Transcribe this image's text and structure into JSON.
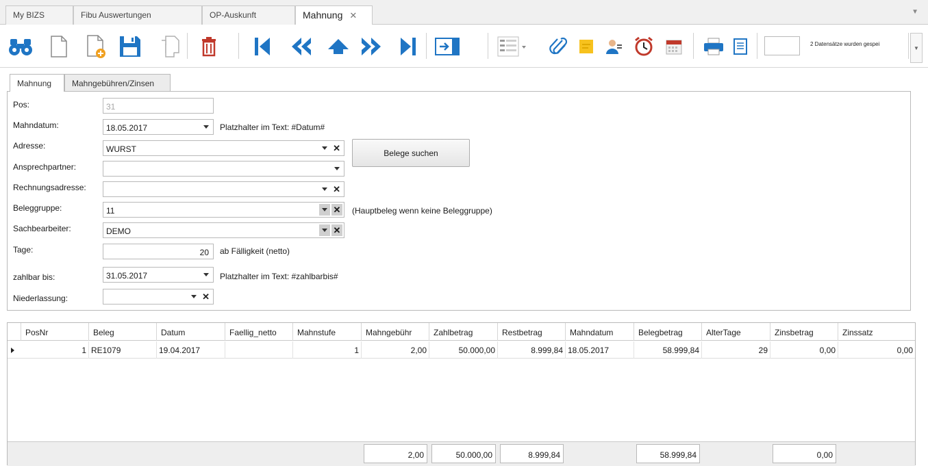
{
  "tabs": [
    {
      "label": "My BIZS"
    },
    {
      "label": "Fibu Auswertungen"
    },
    {
      "label": "OP-Auskunft"
    },
    {
      "label": "Mahnung",
      "close": "✕"
    }
  ],
  "toolbar": {
    "icons": [
      "binoculars-icon",
      "new-document-icon",
      "new-from-template-icon",
      "save-icon",
      "copy-icon",
      "delete-icon",
      "first-record-icon",
      "previous-record-icon",
      "up-icon",
      "next-record-icon",
      "last-record-icon",
      "goto-icon",
      "list-view-icon",
      "attachment-icon",
      "note-icon",
      "contact-icon",
      "alarm-icon",
      "calendar-icon",
      "print-icon",
      "report-icon"
    ],
    "record_input": "",
    "status": "2 Datensätze wurden gespei"
  },
  "form_tabs": [
    {
      "label": "Mahnung"
    },
    {
      "label": "Mahngebühren/Zinsen"
    }
  ],
  "form": {
    "pos_label": "Pos:",
    "pos_value": "31",
    "mahndatum_label": "Mahndatum:",
    "mahndatum_value": "18.05.2017",
    "mahndatum_hint": "Platzhalter im Text:  #Datum#",
    "adresse_label": "Adresse:",
    "adresse_value": "WURST",
    "belege_button": "Belege suchen",
    "ansprechpartner_label": "Ansprechpartner:",
    "ansprechpartner_value": "",
    "rechnungsadresse_label": "Rechnungsadresse:",
    "rechnungsadresse_value": "",
    "beleggruppe_label": "Beleggruppe:",
    "beleggruppe_value": "11",
    "beleggruppe_hint": "(Hauptbeleg wenn keine Beleggruppe)",
    "sachbearbeiter_label": "Sachbearbeiter:",
    "sachbearbeiter_value": "DEMO",
    "tage_label": "Tage:",
    "tage_value": "20",
    "tage_hint": "ab Fälligkeit (netto)",
    "zahlbar_label": "zahlbar bis:",
    "zahlbar_value": "31.05.2017",
    "zahlbar_hint": "Platzhalter im Text:  #zahlbarbis#",
    "niederlassung_label": "Niederlassung:",
    "niederlassung_value": ""
  },
  "grid": {
    "columns": [
      "PosNr",
      "Beleg",
      "Datum",
      "Faellig_netto",
      "Mahnstufe",
      "Mahngebühr",
      "Zahlbetrag",
      "Restbetrag",
      "Mahndatum",
      "Belegbetrag",
      "AlterTage",
      "Zinsbetrag",
      "Zinssatz"
    ],
    "rows": [
      [
        "1",
        "RE1079",
        "19.04.2017",
        "",
        "1",
        "2,00",
        "50.000,00",
        "8.999,84",
        "18.05.2017",
        "58.999,84",
        "29",
        "0,00",
        "0,00"
      ]
    ],
    "totals": {
      "mahngebuehr": "2,00",
      "zahlbetrag": "50.000,00",
      "restbetrag": "8.999,84",
      "belegbetrag": "58.999,84",
      "zinsbetrag": "0,00"
    }
  },
  "colors": {
    "accent_blue": "#1f75c4",
    "delete_red": "#c0392b"
  }
}
